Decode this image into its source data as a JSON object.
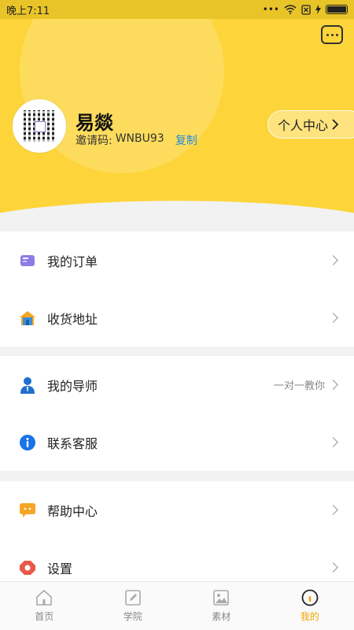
{
  "status": {
    "time": "晚上7:11",
    "signal": "•••"
  },
  "profile": {
    "name": "易燚",
    "invite_label": "邀请码:",
    "invite_code": "WNBU93",
    "copy_label": "复制",
    "personal_center": "个人中心"
  },
  "menu_group1": [
    {
      "label": "我的订单",
      "icon": "order-icon"
    },
    {
      "label": "收货地址",
      "icon": "house-icon"
    }
  ],
  "menu_group2": [
    {
      "label": "我的导师",
      "icon": "person-icon",
      "extra": "一对一教你"
    },
    {
      "label": "联系客服",
      "icon": "info-icon"
    }
  ],
  "menu_group3": [
    {
      "label": "帮助中心",
      "icon": "chat-icon"
    },
    {
      "label": "设置",
      "icon": "settings-icon"
    }
  ],
  "tabs": [
    {
      "label": "首页",
      "icon": "home-icon"
    },
    {
      "label": "学院",
      "icon": "edit-icon"
    },
    {
      "label": "素材",
      "icon": "image-icon"
    },
    {
      "label": "我的",
      "icon": "profile-icon"
    }
  ],
  "colors": {
    "accent": "#fdd53a",
    "tab_active": "#f2a300",
    "link": "#2a8bd8"
  }
}
